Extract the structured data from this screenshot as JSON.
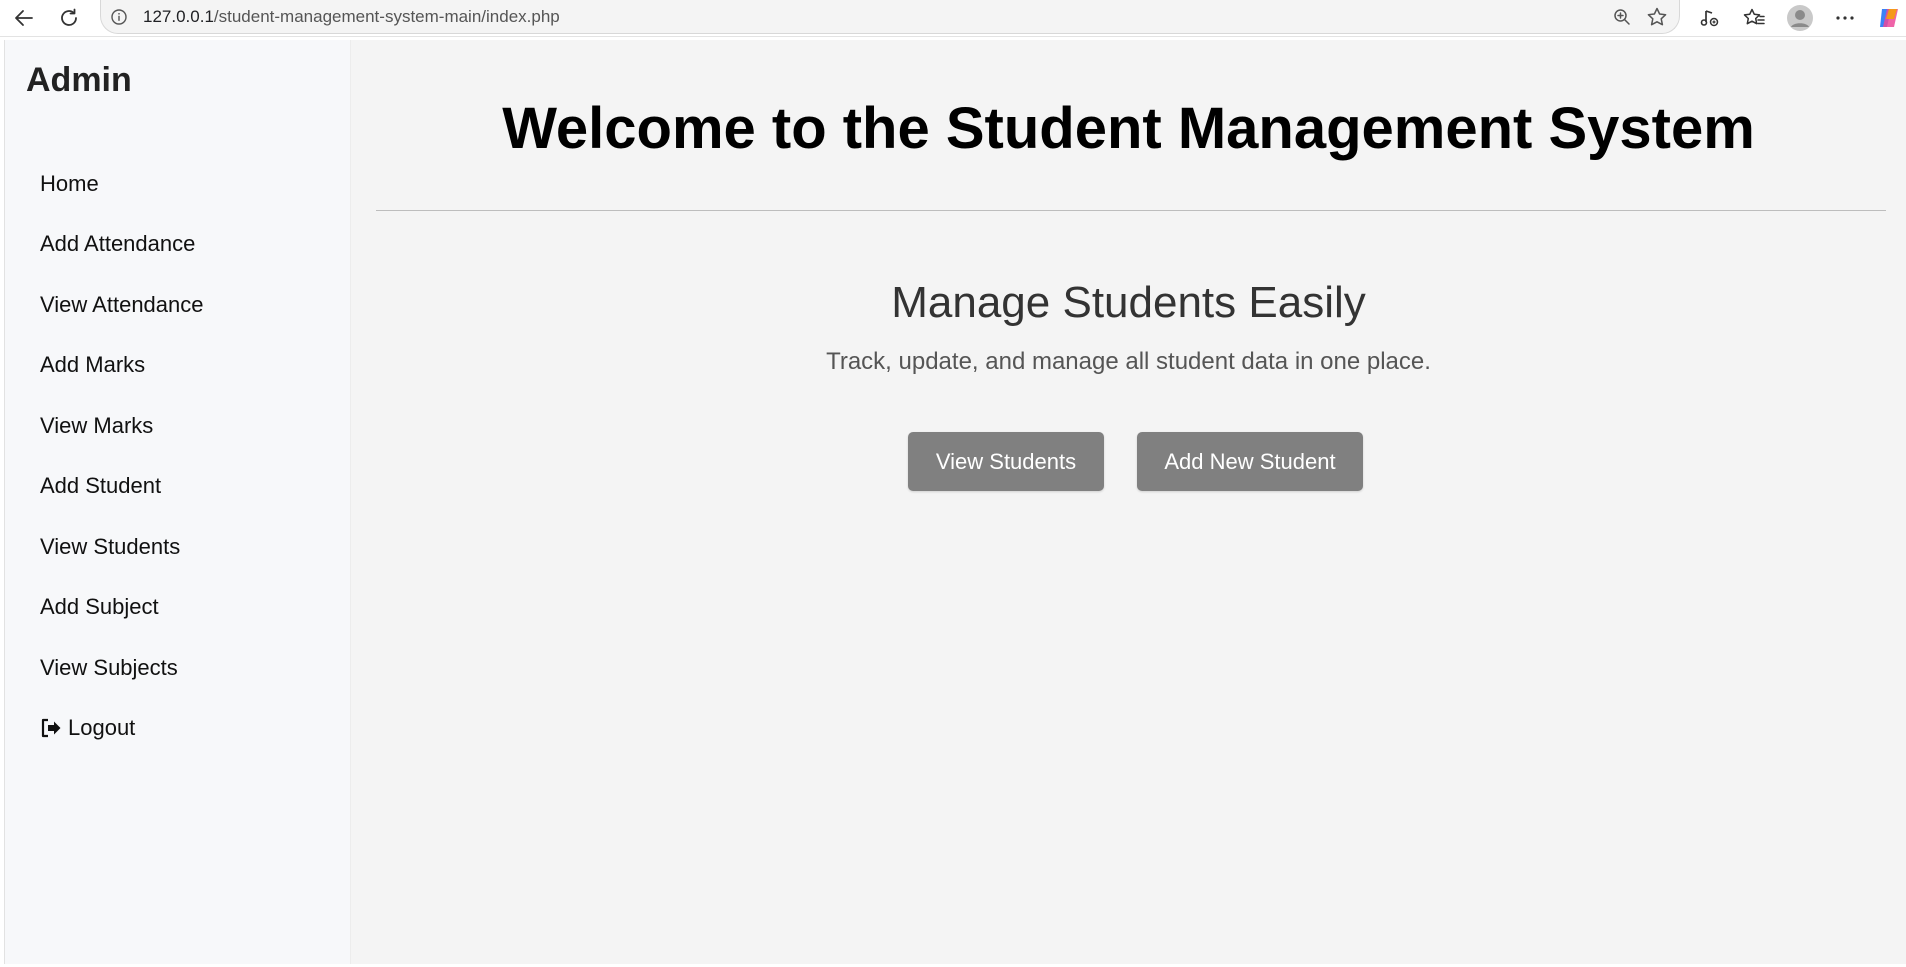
{
  "browser": {
    "url_host": "127.0.0.1",
    "url_path": "/student-management-system-main/index.php",
    "icons": [
      "back-arrow-icon",
      "reload-icon",
      "site-info-icon",
      "zoom-icon",
      "favorite-star-icon",
      "read-aloud-icon",
      "favorites-icon",
      "profile-avatar-icon",
      "more-options-icon",
      "copilot-icon"
    ]
  },
  "sidebar": {
    "title": "Admin",
    "items": [
      {
        "label": "Home"
      },
      {
        "label": "Add Attendance"
      },
      {
        "label": "View Attendance"
      },
      {
        "label": "Add Marks"
      },
      {
        "label": "View Marks"
      },
      {
        "label": "Add Student"
      },
      {
        "label": "View Students"
      },
      {
        "label": "Add Subject"
      },
      {
        "label": "View Subjects"
      },
      {
        "label": "Logout",
        "icon": "logout-icon"
      }
    ]
  },
  "main": {
    "title": "Welcome to the Student Management System",
    "subtitle": "Manage Students Easily",
    "description": "Track, update, and manage all student data in one place.",
    "buttons": {
      "view_students": "View Students",
      "add_new_student": "Add New Student"
    },
    "button_color": "#808080"
  }
}
